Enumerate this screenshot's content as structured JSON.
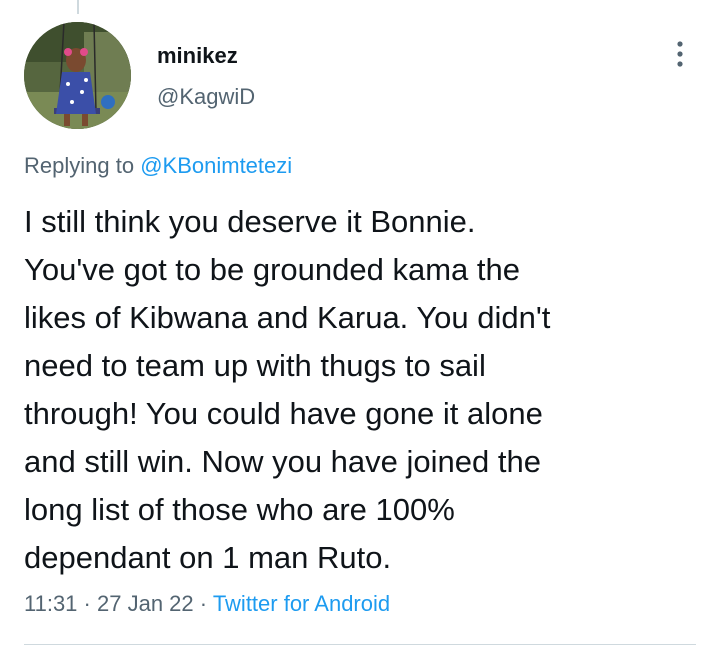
{
  "tweet": {
    "author": {
      "display_name": "minikez",
      "handle": "@KagwiD"
    },
    "replying_prefix": "Replying to",
    "replying_to": "@KBonimtetezi",
    "text_lines": [
      "I still think you deserve it Bonnie.",
      "You've got to be grounded kama the",
      "likes of Kibwana and Karua. You didn't",
      "need to team up with thugs to sail",
      "through! You could have gone it alone",
      "and still win. Now you have joined the",
      "long list of those who are 100%",
      "dependant on 1 man Ruto."
    ],
    "time": "11:31",
    "separator": "·",
    "date": "27 Jan 22",
    "source": "Twitter for Android"
  },
  "icons": {
    "more": "more-vertical-icon"
  },
  "colors": {
    "text": "#0f1419",
    "secondary": "#536471",
    "accent": "#1d9bf0",
    "divider": "#cfd9de"
  }
}
